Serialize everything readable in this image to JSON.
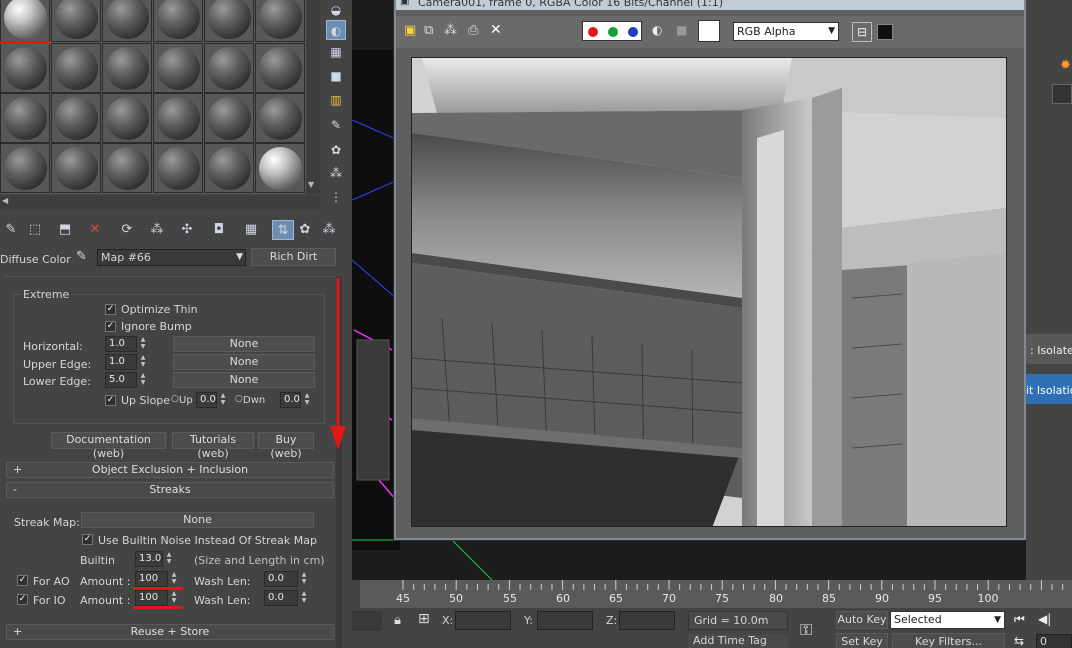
{
  "material_editor": {
    "map_label": "Diffuse Color",
    "map_name": "Map #66",
    "map_type": "Rich Dirt",
    "extreme": {
      "title": "Extreme",
      "optimize_thin": "Optimize Thin",
      "ignore_bump": "Ignore Bump",
      "horizontal_label": "Horizontal:",
      "horizontal_value": "1.0",
      "horizontal_map": "None",
      "upper_label": "Upper Edge:",
      "upper_value": "1.0",
      "upper_map": "None",
      "lower_label": "Lower Edge:",
      "lower_value": "5.0",
      "lower_map": "None",
      "up_slope": "Up Slope",
      "up_label": "Up",
      "up_value": "0.0",
      "dwn_label": "Dwn",
      "dwn_value": "0.0"
    },
    "links": [
      "Documentation (web)",
      "Tutorials (web)",
      "Buy (web)"
    ],
    "rollouts": {
      "exclusion": "Object Exclusion + Inclusion",
      "streaks": "Streaks",
      "reuse": "Reuse + Store"
    },
    "streaks": {
      "map_label": "Streak Map:",
      "map_value": "None",
      "builtin_noise": "Use Builtin Noise Instead Of Streak Map",
      "builtin_label": "Builtin",
      "builtin_value": "13.0",
      "builtin_hint": "(Size and Length in cm)",
      "for_ao": "For AO",
      "for_io": "For IO",
      "amount_label": "Amount :",
      "ao_amount": "100",
      "io_amount": "100",
      "wash_label": "Wash Len:",
      "ao_wash": "0.0",
      "io_wash": "0.0"
    }
  },
  "frame_buffer": {
    "title": "Camera001, frame 0, RGBA Color 16 Bits/Channel (1:1)",
    "channel": "RGB Alpha"
  },
  "viewport": {
    "isolate_1": ": Isolate",
    "isolate_2": "it Isolation"
  },
  "timeline": {
    "ticks": [
      "45",
      "50",
      "55",
      "60",
      "65",
      "70",
      "75",
      "80",
      "85",
      "90",
      "95",
      "100"
    ]
  },
  "status": {
    "x_label": "X:",
    "y_label": "Y:",
    "z_label": "Z:",
    "grid": "Grid = 10.0m",
    "add_time_tag": "Add Time Tag",
    "auto_key": "Auto Key",
    "set_key": "Set Key",
    "selected": "Selected",
    "key_filters": "Key Filters...",
    "frame": "0"
  }
}
